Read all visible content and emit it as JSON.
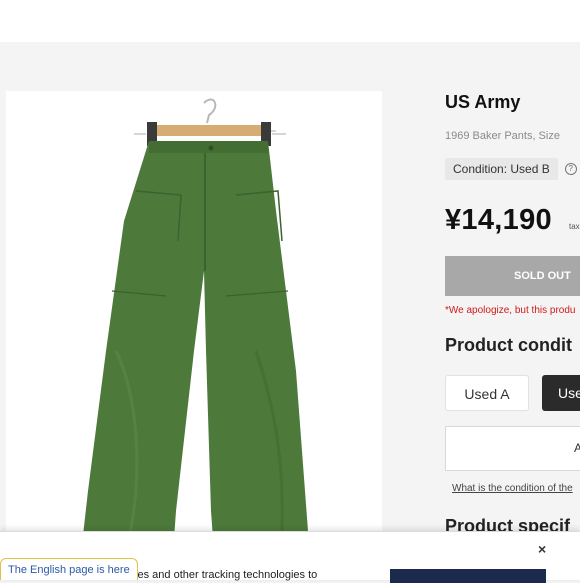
{
  "product": {
    "brand": "US Army",
    "subtitle": "1969 Baker Pants, Size",
    "condition_badge": "Condition: Used B",
    "help_icon": "?",
    "price": "¥14,190",
    "tax_label": "tax",
    "sold_out_label": "SOLD OUT",
    "apology_text": "*We apologize, but this produ",
    "image_name": "green-baker-pants-photo"
  },
  "condition_section": {
    "title": "Product condit",
    "tabs": [
      {
        "label": "Used A",
        "selected": false
      },
      {
        "label": "Use",
        "selected": true
      }
    ],
    "box_text": "A",
    "link_text": "What is the condition of the"
  },
  "spec_section": {
    "title": "Product specif"
  },
  "cookie_banner": {
    "text": "ties and other tracking technologies to",
    "close_icon": "×"
  },
  "english_link": "The English page is here",
  "colors": {
    "page_bg": "#f4f4f4",
    "pants_green": "#4d7a3a",
    "sold_out_gray": "#a8a8a8",
    "apology_red": "#d21a1a",
    "selected_tab": "#2b2b2b",
    "cookie_button": "#1c2a4d",
    "link_blue": "#2b5aa8"
  }
}
